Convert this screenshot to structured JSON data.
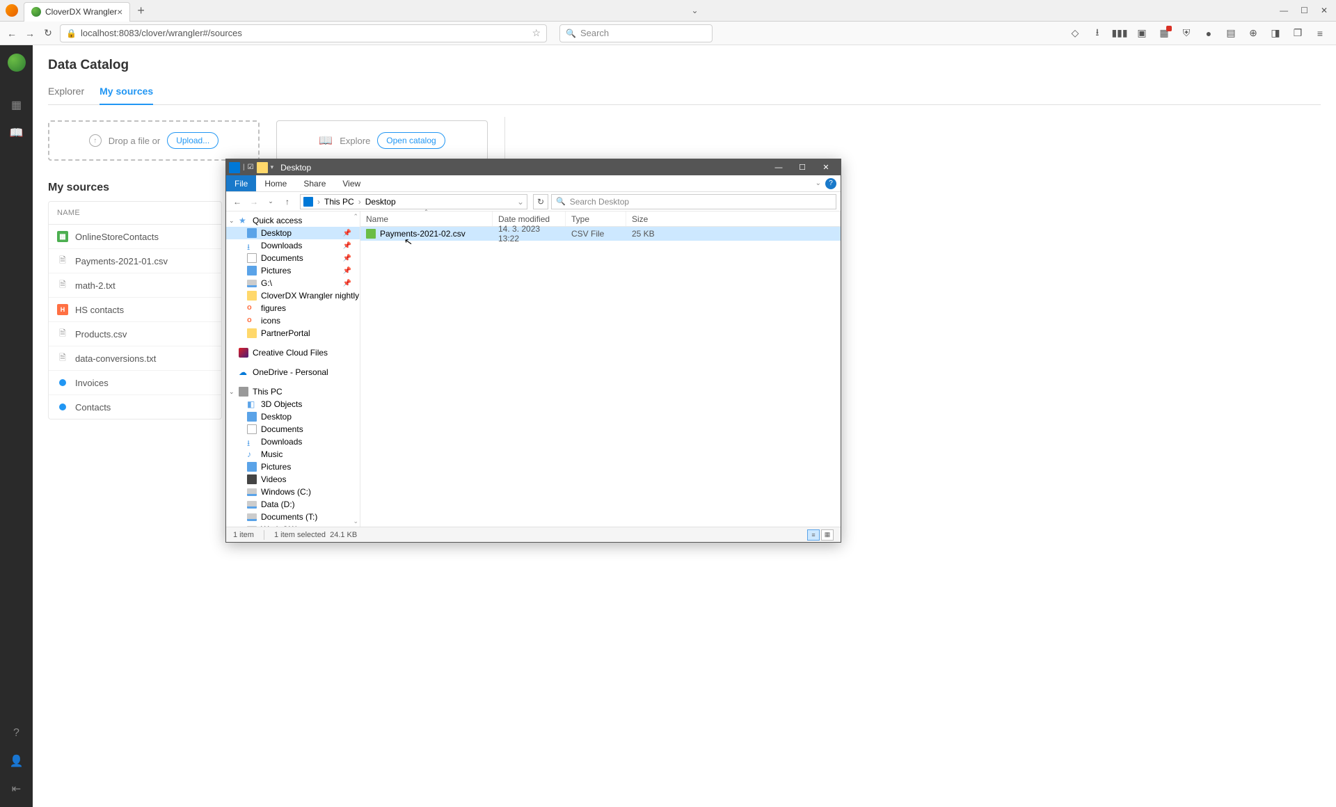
{
  "browser": {
    "tab_title": "CloverDX Wrangler",
    "url": "localhost:8083/clover/wrangler#/sources",
    "search_placeholder": "Search"
  },
  "app": {
    "title": "Data Catalog",
    "tabs": {
      "explorer": "Explorer",
      "my_sources": "My sources"
    },
    "dropzone": {
      "label": "Drop a file or",
      "button": "Upload..."
    },
    "explore": {
      "label": "Explore",
      "button": "Open catalog"
    },
    "section_title": "My sources",
    "name_header": "NAME",
    "sources": [
      {
        "icon": "g",
        "label": "OnlineStoreContacts"
      },
      {
        "icon": "file",
        "label": "Payments-2021-01.csv"
      },
      {
        "icon": "file",
        "label": "math-2.txt"
      },
      {
        "icon": "hs",
        "label": "HS contacts"
      },
      {
        "icon": "file",
        "label": "Products.csv"
      },
      {
        "icon": "file",
        "label": "data-conversions.txt"
      },
      {
        "icon": "blue",
        "label": "Invoices"
      },
      {
        "icon": "blue",
        "label": "Contacts"
      }
    ]
  },
  "explorer": {
    "title": "Desktop",
    "ribbon": {
      "file": "File",
      "home": "Home",
      "share": "Share",
      "view": "View"
    },
    "breadcrumb": {
      "this_pc": "This PC",
      "desktop": "Desktop"
    },
    "search_placeholder": "Search Desktop",
    "columns": {
      "name": "Name",
      "date": "Date modified",
      "type": "Type",
      "size": "Size"
    },
    "tree": {
      "quick_access": "Quick access",
      "desktop": "Desktop",
      "downloads": "Downloads",
      "documents": "Documents",
      "pictures": "Pictures",
      "g_drive": "G:\\",
      "cdx_nightly": "CloverDX Wrangler nightly",
      "figures": "figures",
      "icons": "icons",
      "partner_portal": "PartnerPortal",
      "cc": "Creative Cloud Files",
      "od": "OneDrive - Personal",
      "this_pc": "This PC",
      "3d": "3D Objects",
      "desktop2": "Desktop",
      "documents2": "Documents",
      "downloads2": "Downloads",
      "music": "Music",
      "pictures2": "Pictures",
      "videos": "Videos",
      "win_c": "Windows (C:)",
      "data_d": "Data (D:)",
      "docs_t": "Documents (T:)",
      "work_w": "Work (W:)"
    },
    "file": {
      "name": "Payments-2021-02.csv",
      "date": "14. 3. 2023 13:22",
      "type": "CSV File",
      "size": "25 KB"
    },
    "status": {
      "items": "1 item",
      "selected": "1 item selected",
      "sel_size": "24.1 KB"
    }
  }
}
